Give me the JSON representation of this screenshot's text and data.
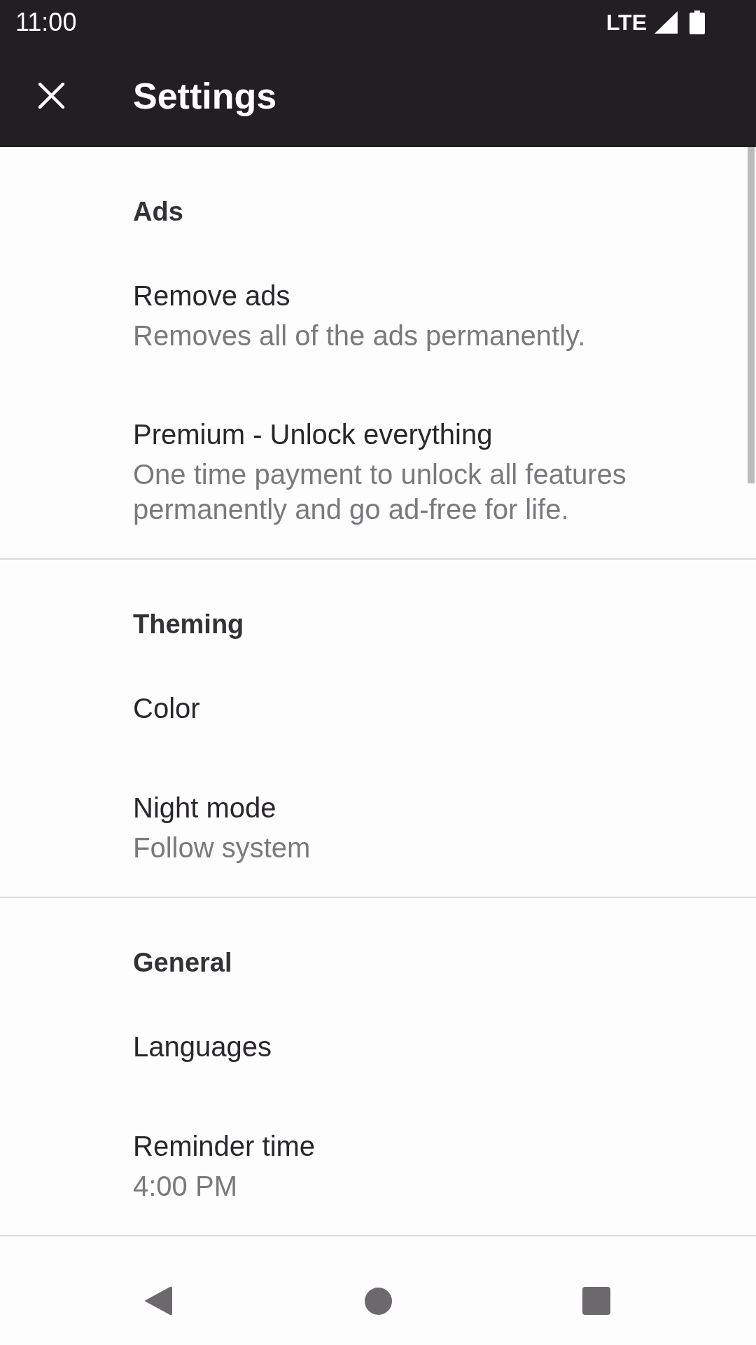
{
  "status_bar": {
    "time": "11:00",
    "network": "LTE"
  },
  "app_bar": {
    "title": "Settings"
  },
  "sections": [
    {
      "header": "Ads",
      "items": [
        {
          "title": "Remove ads",
          "summary": "Removes all of the ads permanently."
        },
        {
          "title": "Premium - Unlock everything",
          "summary": "One time payment to unlock all features permanently and go ad-free for life."
        }
      ]
    },
    {
      "header": "Theming",
      "items": [
        {
          "title": "Color"
        },
        {
          "title": "Night mode",
          "summary": "Follow system"
        }
      ]
    },
    {
      "header": "General",
      "items": [
        {
          "title": "Languages"
        },
        {
          "title": "Reminder time",
          "summary": "4:00 PM"
        }
      ]
    }
  ]
}
